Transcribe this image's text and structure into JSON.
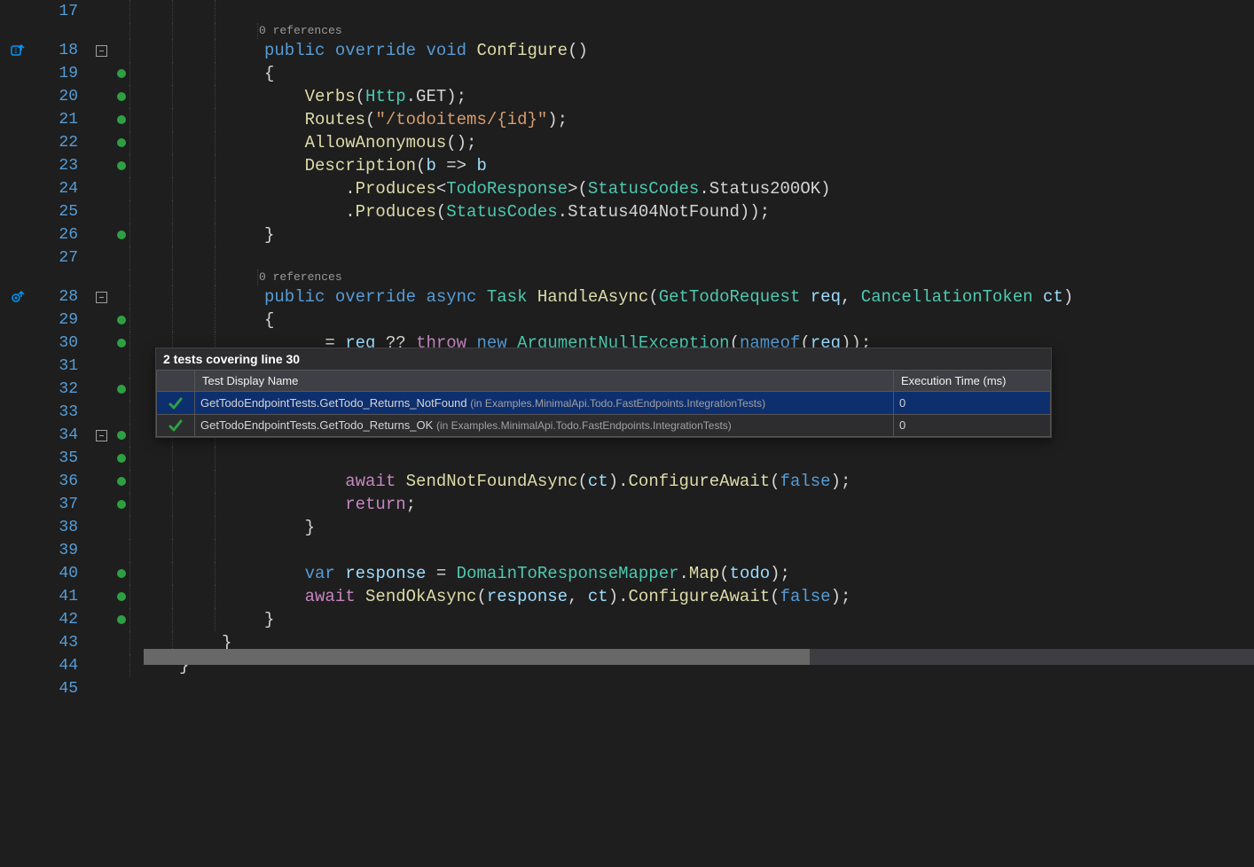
{
  "lines": {
    "17": {
      "glyph": "",
      "fold": false,
      "cov": false,
      "indent": 3,
      "tokens": []
    },
    "cl1": {
      "codelens": "0 references",
      "indent": 4
    },
    "18": {
      "glyph": "io",
      "fold": true,
      "cov": false,
      "indent": 3,
      "tokens": [
        [
          "kw",
          "public"
        ],
        [
          "white",
          " "
        ],
        [
          "kw",
          "override"
        ],
        [
          "white",
          " "
        ],
        [
          "kw",
          "void"
        ],
        [
          "white",
          " "
        ],
        [
          "method",
          "Configure"
        ],
        [
          "white",
          "()"
        ]
      ]
    },
    "19": {
      "glyph": "",
      "fold": false,
      "cov": true,
      "indent": 3,
      "tokens": [
        [
          "white",
          "{"
        ]
      ]
    },
    "20": {
      "glyph": "",
      "fold": false,
      "cov": true,
      "indent": 3,
      "tokens": [
        [
          "white",
          "    "
        ],
        [
          "method",
          "Verbs"
        ],
        [
          "white",
          "("
        ],
        [
          "type",
          "Http"
        ],
        [
          "white",
          "."
        ],
        [
          "prop",
          "GET"
        ],
        [
          "white",
          ");"
        ]
      ]
    },
    "21": {
      "glyph": "",
      "fold": false,
      "cov": true,
      "indent": 3,
      "tokens": [
        [
          "white",
          "    "
        ],
        [
          "method",
          "Routes"
        ],
        [
          "white",
          "("
        ],
        [
          "str",
          "\"/todoitems/{id}\""
        ],
        [
          "white",
          ");"
        ]
      ]
    },
    "22": {
      "glyph": "",
      "fold": false,
      "cov": true,
      "indent": 3,
      "tokens": [
        [
          "white",
          "    "
        ],
        [
          "method",
          "AllowAnonymous"
        ],
        [
          "white",
          "();"
        ]
      ]
    },
    "23": {
      "glyph": "",
      "fold": false,
      "cov": true,
      "indent": 3,
      "tokens": [
        [
          "white",
          "    "
        ],
        [
          "method",
          "Description"
        ],
        [
          "white",
          "("
        ],
        [
          "param",
          "b"
        ],
        [
          "white",
          " => "
        ],
        [
          "param",
          "b"
        ]
      ]
    },
    "24": {
      "glyph": "",
      "fold": false,
      "cov": false,
      "indent": 3,
      "tokens": [
        [
          "white",
          "        ."
        ],
        [
          "method",
          "Produces"
        ],
        [
          "white",
          "<"
        ],
        [
          "type",
          "TodoResponse"
        ],
        [
          "white",
          ">("
        ],
        [
          "type",
          "StatusCodes"
        ],
        [
          "white",
          "."
        ],
        [
          "prop",
          "Status200OK"
        ],
        [
          "white",
          ")"
        ]
      ]
    },
    "25": {
      "glyph": "",
      "fold": false,
      "cov": false,
      "indent": 3,
      "tokens": [
        [
          "white",
          "        ."
        ],
        [
          "method",
          "Produces"
        ],
        [
          "white",
          "("
        ],
        [
          "type",
          "StatusCodes"
        ],
        [
          "white",
          "."
        ],
        [
          "prop",
          "Status404NotFound"
        ],
        [
          "white",
          "));"
        ]
      ]
    },
    "26": {
      "glyph": "",
      "fold": false,
      "cov": true,
      "indent": 3,
      "tokens": [
        [
          "white",
          "}"
        ]
      ]
    },
    "27": {
      "glyph": "",
      "fold": false,
      "cov": false,
      "indent": 3,
      "tokens": []
    },
    "cl2": {
      "codelens": "0 references",
      "indent": 4
    },
    "28": {
      "glyph": "eye",
      "fold": true,
      "cov": false,
      "indent": 3,
      "tokens": [
        [
          "kw",
          "public"
        ],
        [
          "white",
          " "
        ],
        [
          "kw",
          "override"
        ],
        [
          "white",
          " "
        ],
        [
          "kw",
          "async"
        ],
        [
          "white",
          " "
        ],
        [
          "type",
          "Task"
        ],
        [
          "white",
          " "
        ],
        [
          "method",
          "HandleAsync"
        ],
        [
          "white",
          "("
        ],
        [
          "type",
          "GetTodoRequest"
        ],
        [
          "white",
          " "
        ],
        [
          "param",
          "req"
        ],
        [
          "white",
          ", "
        ],
        [
          "type",
          "CancellationToken"
        ],
        [
          "white",
          " "
        ],
        [
          "param",
          "ct"
        ],
        [
          "white",
          ")"
        ]
      ]
    },
    "29": {
      "glyph": "",
      "fold": false,
      "cov": true,
      "indent": 3,
      "tokens": [
        [
          "white",
          "{"
        ]
      ]
    },
    "30": {
      "glyph": "",
      "fold": false,
      "cov": true,
      "indent": 3,
      "tokens": [
        [
          "white",
          "    "
        ],
        [
          "param",
          "_"
        ],
        [
          "white",
          " = "
        ],
        [
          "param",
          "req"
        ],
        [
          "white",
          " ?? "
        ],
        [
          "ctrl",
          "throw"
        ],
        [
          "white",
          " "
        ],
        [
          "kw",
          "new"
        ],
        [
          "white",
          " "
        ],
        [
          "type",
          "ArgumentNullException"
        ],
        [
          "white",
          "("
        ],
        [
          "kw",
          "nameof"
        ],
        [
          "white",
          "("
        ],
        [
          "param",
          "req"
        ],
        [
          "white",
          "));"
        ]
      ]
    },
    "31": {
      "glyph": "",
      "fold": false,
      "cov": false,
      "indent": 3,
      "tokens": []
    },
    "32": {
      "glyph": "",
      "fold": false,
      "cov": true,
      "indent": 3,
      "tokens": []
    },
    "33": {
      "glyph": "",
      "fold": false,
      "cov": false,
      "indent": 3,
      "tokens": []
    },
    "34": {
      "glyph": "",
      "fold": true,
      "cov": true,
      "indent": 3,
      "tokens": []
    },
    "35": {
      "glyph": "",
      "fold": false,
      "cov": true,
      "indent": 3,
      "tokens": []
    },
    "36": {
      "glyph": "",
      "fold": false,
      "cov": true,
      "indent": 3,
      "tokens": [
        [
          "white",
          "        "
        ],
        [
          "ctrl",
          "await"
        ],
        [
          "white",
          " "
        ],
        [
          "method",
          "SendNotFoundAsync"
        ],
        [
          "white",
          "("
        ],
        [
          "param",
          "ct"
        ],
        [
          "white",
          ")."
        ],
        [
          "method",
          "ConfigureAwait"
        ],
        [
          "white",
          "("
        ],
        [
          "kw",
          "false"
        ],
        [
          "white",
          ");"
        ]
      ]
    },
    "37": {
      "glyph": "",
      "fold": false,
      "cov": true,
      "indent": 3,
      "tokens": [
        [
          "white",
          "        "
        ],
        [
          "ctrl",
          "return"
        ],
        [
          "white",
          ";"
        ]
      ]
    },
    "38": {
      "glyph": "",
      "fold": false,
      "cov": false,
      "indent": 3,
      "tokens": [
        [
          "white",
          "    }"
        ]
      ]
    },
    "39": {
      "glyph": "",
      "fold": false,
      "cov": false,
      "indent": 3,
      "tokens": []
    },
    "40": {
      "glyph": "",
      "fold": false,
      "cov": true,
      "indent": 3,
      "tokens": [
        [
          "white",
          "    "
        ],
        [
          "kw",
          "var"
        ],
        [
          "white",
          " "
        ],
        [
          "param",
          "response"
        ],
        [
          "white",
          " = "
        ],
        [
          "type",
          "DomainToResponseMapper"
        ],
        [
          "white",
          "."
        ],
        [
          "method",
          "Map"
        ],
        [
          "white",
          "("
        ],
        [
          "param",
          "todo"
        ],
        [
          "white",
          ");"
        ]
      ]
    },
    "41": {
      "glyph": "",
      "fold": false,
      "cov": true,
      "indent": 3,
      "tokens": [
        [
          "white",
          "    "
        ],
        [
          "ctrl",
          "await"
        ],
        [
          "white",
          " "
        ],
        [
          "method",
          "SendOkAsync"
        ],
        [
          "white",
          "("
        ],
        [
          "param",
          "response"
        ],
        [
          "white",
          ", "
        ],
        [
          "param",
          "ct"
        ],
        [
          "white",
          ")."
        ],
        [
          "method",
          "ConfigureAwait"
        ],
        [
          "white",
          "("
        ],
        [
          "kw",
          "false"
        ],
        [
          "white",
          ");"
        ]
      ]
    },
    "42": {
      "glyph": "",
      "fold": false,
      "cov": true,
      "indent": 3,
      "tokens": [
        [
          "white",
          "}"
        ]
      ]
    },
    "43": {
      "glyph": "",
      "fold": false,
      "cov": false,
      "indent": 2,
      "tokens": [
        [
          "white",
          "}"
        ]
      ]
    },
    "44": {
      "glyph": "",
      "fold": false,
      "cov": false,
      "indent": 1,
      "tokens": [
        [
          "white",
          "}"
        ]
      ]
    },
    "45": {
      "glyph": "",
      "fold": false,
      "cov": false,
      "indent": 0,
      "tokens": []
    }
  },
  "lineOrder": [
    "17",
    "cl1",
    "18",
    "19",
    "20",
    "21",
    "22",
    "23",
    "24",
    "25",
    "26",
    "27",
    "cl2",
    "28",
    "29",
    "30",
    "31",
    "32",
    "33",
    "34",
    "35",
    "36",
    "37",
    "38",
    "39",
    "40",
    "41",
    "42",
    "43",
    "44",
    "45"
  ],
  "popup": {
    "title": "2 tests covering line 30",
    "headers": {
      "name": "Test Display Name",
      "time": "Execution Time (ms)"
    },
    "rows": [
      {
        "selected": true,
        "status": "pass",
        "name": "GetTodoEndpointTests.GetTodo_Returns_NotFound",
        "ns": "(in Examples.MinimalApi.Todo.FastEndpoints.IntegrationTests)",
        "time": "0"
      },
      {
        "selected": false,
        "status": "pass",
        "name": "GetTodoEndpointTests.GetTodo_Returns_OK",
        "ns": "(in Examples.MinimalApi.Todo.FastEndpoints.IntegrationTests)",
        "time": "0"
      }
    ]
  }
}
